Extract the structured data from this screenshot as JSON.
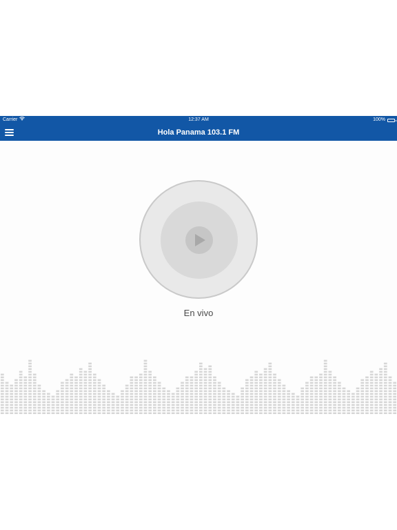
{
  "status_bar": {
    "carrier": "Carrier",
    "wifi_icon": "wifi-icon",
    "time": "12:37 AM",
    "battery": "100%",
    "battery_icon": "battery-icon"
  },
  "nav_bar": {
    "menu_icon": "hamburger-menu-icon",
    "title": "Hola Panama 103.1 FM"
  },
  "player": {
    "play_icon": "play-icon",
    "status_label": "En vivo"
  },
  "equalizer": {
    "color": "#d6d6d6",
    "levels": [
      0.75,
      0.6,
      0.55,
      0.65,
      0.8,
      0.7,
      1.0,
      0.75,
      0.55,
      0.45,
      0.4,
      0.35,
      0.45,
      0.6,
      0.65,
      0.75,
      0.7,
      0.85,
      0.8,
      0.95,
      0.75,
      0.65,
      0.55,
      0.45,
      0.4,
      0.35,
      0.45,
      0.55,
      0.7,
      0.7,
      0.75,
      1.0,
      0.8,
      0.7,
      0.6,
      0.5,
      0.45,
      0.4,
      0.5,
      0.6,
      0.7,
      0.7,
      0.8,
      0.95,
      0.85,
      0.9,
      0.7,
      0.6,
      0.5,
      0.45,
      0.4,
      0.35,
      0.5,
      0.65,
      0.7,
      0.8,
      0.75,
      0.85,
      0.95,
      0.75,
      0.65,
      0.55,
      0.45,
      0.4,
      0.35,
      0.5,
      0.6,
      0.7,
      0.7,
      0.75,
      1.0,
      0.8,
      0.7,
      0.6,
      0.5,
      0.45,
      0.4,
      0.5,
      0.65,
      0.7,
      0.8,
      0.75,
      0.85,
      0.95,
      0.7,
      0.6
    ],
    "colors": {
      "accent": "#1257a6",
      "player_outer": "#e9e9e9",
      "player_inner": "#d9d9d9",
      "play_button": "#c6c6c6"
    }
  }
}
